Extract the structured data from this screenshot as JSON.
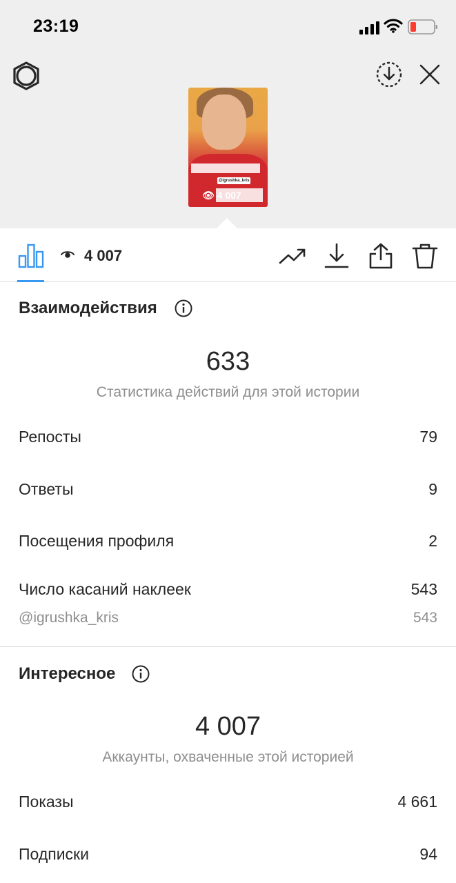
{
  "status_bar": {
    "time": "23:19"
  },
  "tabs": {
    "views_count": "4 007"
  },
  "thumbnail": {
    "tag": "@igrushka_kris",
    "overlay_count": "4 007"
  },
  "interactions": {
    "title": "Взаимодействия",
    "total": "633",
    "caption": "Статистика действий для этой истории",
    "rows": [
      {
        "label": "Репосты",
        "value": "79"
      },
      {
        "label": "Ответы",
        "value": "9"
      },
      {
        "label": "Посещения профиля",
        "value": "2"
      },
      {
        "label": "Число касаний наклеек",
        "value": "543"
      }
    ],
    "sticker": {
      "label": "@igrushka_kris",
      "value": "543"
    }
  },
  "discovery": {
    "title": "Интересное",
    "total": "4 007",
    "caption": "Аккаунты, охваченные этой историей",
    "rows": [
      {
        "label": "Показы",
        "value": "4 661"
      },
      {
        "label": "Подписки",
        "value": "94"
      }
    ]
  },
  "colors": {
    "accent": "#3897f0",
    "muted": "#8e8e8e",
    "battery_low": "#ff3b30"
  },
  "icons": [
    "settings-icon",
    "download-circle-icon",
    "close-icon",
    "bar-chart-icon",
    "eye-icon",
    "trending-icon",
    "download-icon",
    "share-icon",
    "trash-icon",
    "info-icon"
  ]
}
